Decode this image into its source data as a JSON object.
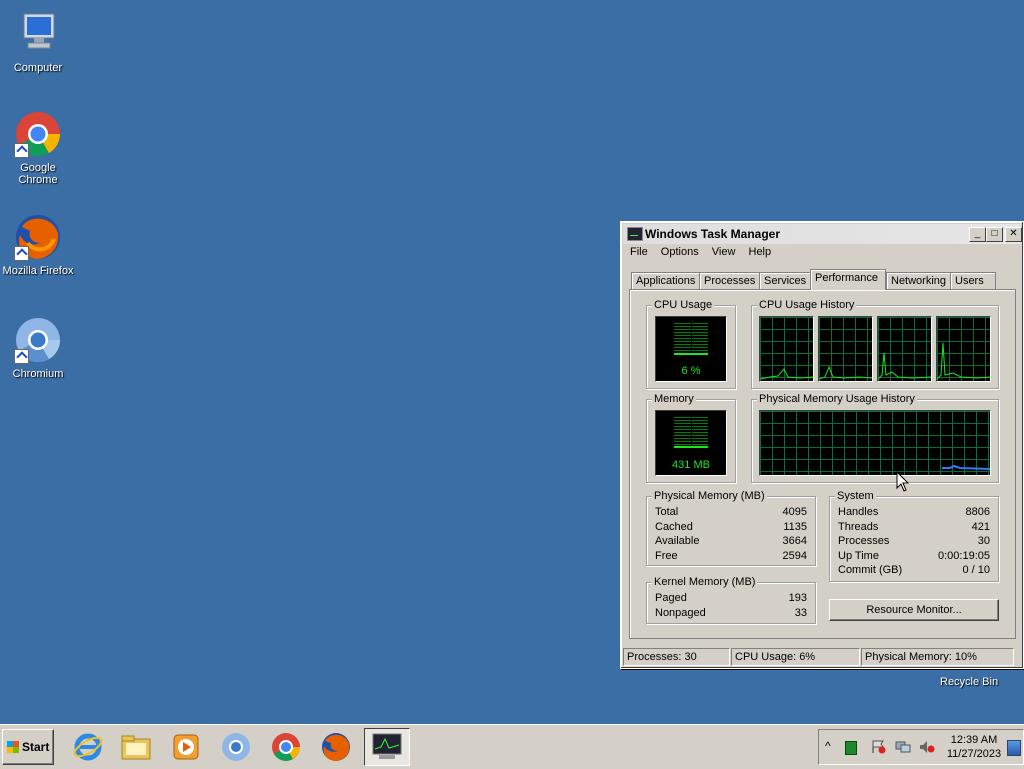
{
  "desktop": {
    "icons": [
      {
        "label": "Computer",
        "icon": "computer-icon"
      },
      {
        "label": "Google Chrome",
        "icon": "chrome-icon"
      },
      {
        "label": "Mozilla Firefox",
        "icon": "firefox-icon"
      },
      {
        "label": "Chromium",
        "icon": "chromium-icon"
      }
    ],
    "recycle_bin": "Recycle Bin",
    "background": "#3a6ea5"
  },
  "window": {
    "title": "Windows Task Manager",
    "menu": [
      "File",
      "Options",
      "View",
      "Help"
    ],
    "tabs": [
      "Applications",
      "Processes",
      "Services",
      "Performance",
      "Networking",
      "Users"
    ],
    "selected_tab": "Performance",
    "controls": {
      "minimize": "_",
      "maximize": "□",
      "close": "✕"
    }
  },
  "performance": {
    "cpu_usage_label": "CPU Usage",
    "cpu_usage_value": "6 %",
    "cpu_history_label": "CPU Usage History",
    "memory_label": "Memory",
    "memory_value": "431 MB",
    "memory_history_label": "Physical Memory Usage History",
    "physical_memory": {
      "label": "Physical Memory (MB)",
      "rows": [
        {
          "k": "Total",
          "v": "4095"
        },
        {
          "k": "Cached",
          "v": "1135"
        },
        {
          "k": "Available",
          "v": "3664"
        },
        {
          "k": "Free",
          "v": "2594"
        }
      ]
    },
    "kernel_memory": {
      "label": "Kernel Memory (MB)",
      "rows": [
        {
          "k": "Paged",
          "v": "193"
        },
        {
          "k": "Nonpaged",
          "v": "33"
        }
      ]
    },
    "system": {
      "label": "System",
      "rows": [
        {
          "k": "Handles",
          "v": "8806"
        },
        {
          "k": "Threads",
          "v": "421"
        },
        {
          "k": "Processes",
          "v": "30"
        },
        {
          "k": "Up Time",
          "v": "0:00:19:05"
        },
        {
          "k": "Commit (GB)",
          "v": "0 / 10"
        }
      ]
    },
    "resource_monitor_button": "Resource Monitor...",
    "cpu_level_fraction": 0.06,
    "memory_level_fraction": 0.1
  },
  "statusbar": {
    "processes": "Processes: 30",
    "cpu": "CPU Usage: 6%",
    "memory": "Physical Memory: 10%"
  },
  "taskbar": {
    "start_label": "Start",
    "pinned": [
      "internet-explorer-icon",
      "explorer-folder-icon",
      "media-player-icon",
      "chromium-icon",
      "chrome-icon",
      "firefox-icon",
      "task-manager-icon"
    ],
    "time": "12:39 AM",
    "date": "11/27/2023",
    "tray_expand": "^"
  }
}
